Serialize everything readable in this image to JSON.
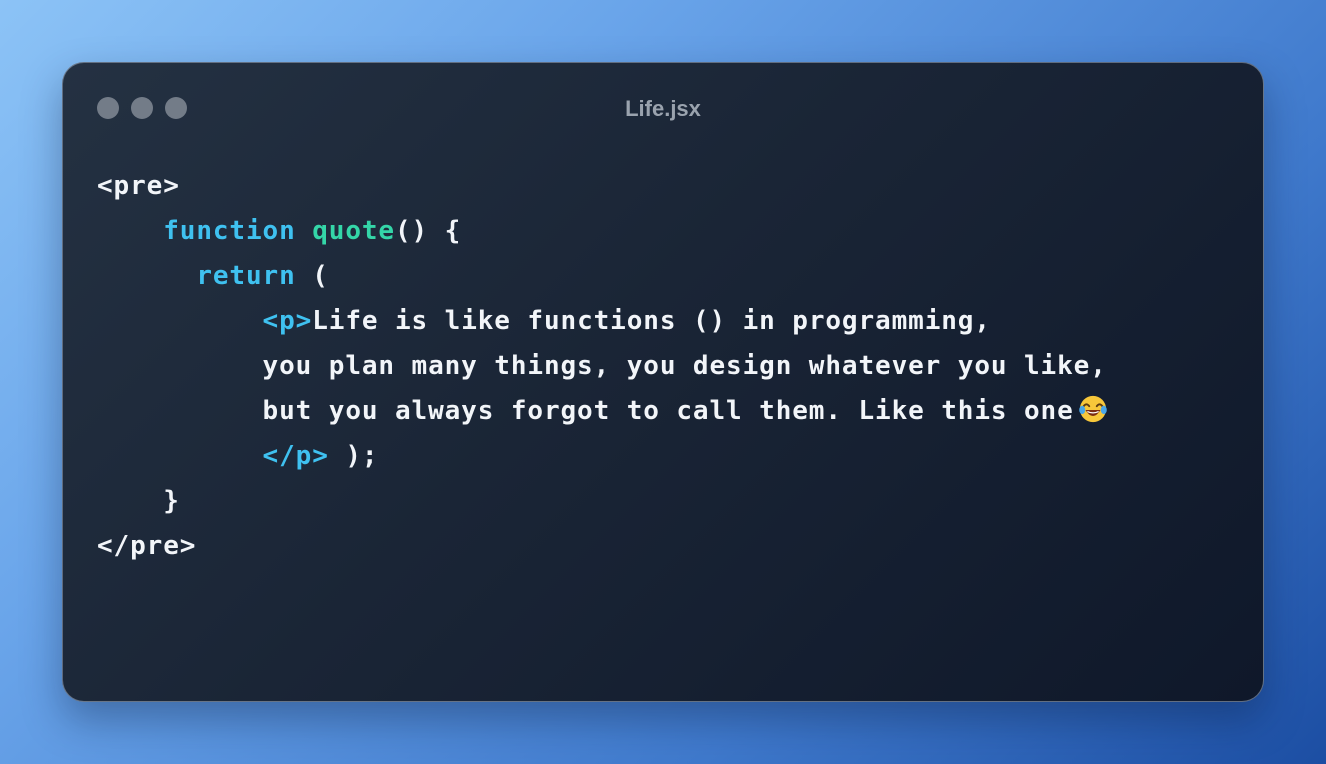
{
  "window": {
    "title": "Life.jsx",
    "traffic_lights": [
      "close",
      "minimize",
      "maximize"
    ]
  },
  "code": {
    "line1": "<pre>",
    "line2_keyword": "function",
    "line2_name": "quote",
    "line2_rest": "() {",
    "line3_keyword": "return",
    "line3_rest": " (",
    "line4_open_tag": "<p>",
    "line4_text": "Life is like functions () in programming,",
    "line5_text": "you plan many things, you design whatever you like,",
    "line6_text": "but you always forgot to call them. Like this one",
    "line6_emoji": "face-with-tears-of-joy-emoji",
    "line7_close_tag": "</p>",
    "line7_rest": " );",
    "line8": "}",
    "line9": "</pre>"
  },
  "colors": {
    "keyword": "#3fc1f0",
    "function_name": "#34d6a8",
    "tag": "#3fc1f0",
    "text": "#f2f5f9",
    "dot": "#737c88"
  }
}
